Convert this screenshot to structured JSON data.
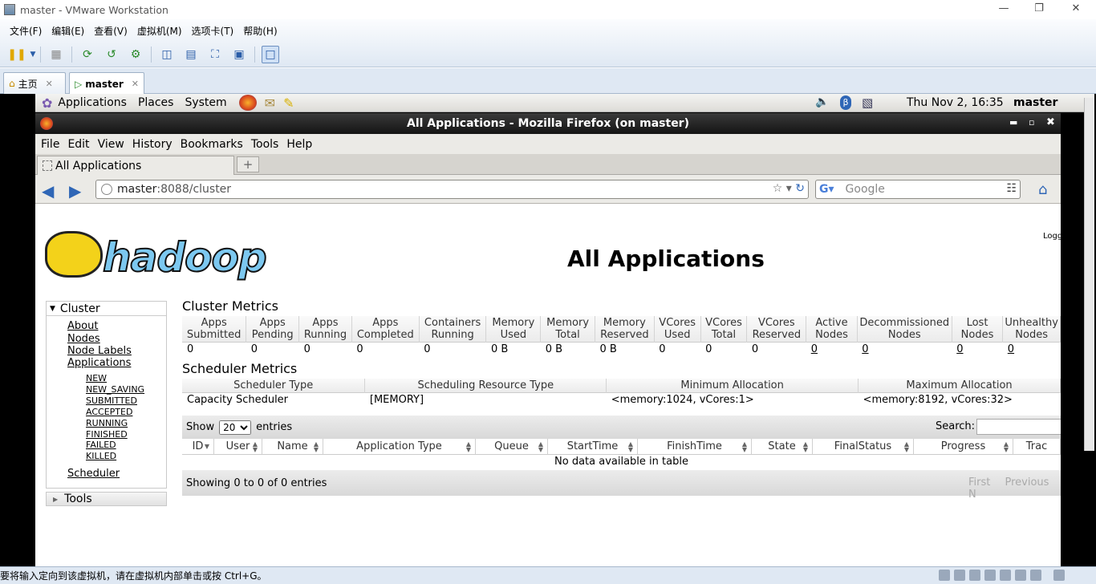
{
  "vm": {
    "title": "master - VMware Workstation",
    "menu": [
      "文件(F)",
      "编辑(E)",
      "查看(V)",
      "虚拟机(M)",
      "选项卡(T)",
      "帮助(H)"
    ],
    "tabs": [
      {
        "label": "主页"
      },
      {
        "label": "master"
      }
    ],
    "status_text": "要将输入定向到该虚拟机，请在虚拟机内部单击或按 Ctrl+G。"
  },
  "gnome": {
    "menus": [
      "Applications",
      "Places",
      "System"
    ],
    "clock": "Thu Nov  2, 16:35",
    "user": "master"
  },
  "firefox": {
    "window_title": "All Applications - Mozilla Firefox (on master)",
    "menu": [
      "File",
      "Edit",
      "View",
      "History",
      "Bookmarks",
      "Tools",
      "Help"
    ],
    "tab_title": "All Applications",
    "url_host": "master",
    "url_rest": ":8088/cluster",
    "search_placeholder": "Google"
  },
  "page": {
    "title": "All Applications",
    "logged": "Logg",
    "logo_text": "hadoop",
    "cluster_label": "Cluster",
    "nav": [
      "About",
      "Nodes",
      "Node Labels",
      "Applications"
    ],
    "app_states": [
      "NEW",
      "NEW_SAVING",
      "SUBMITTED",
      "ACCEPTED",
      "RUNNING",
      "FINISHED",
      "FAILED",
      "KILLED"
    ],
    "scheduler_link": "Scheduler",
    "tools_label": "Tools",
    "cluster_metrics_title": "Cluster Metrics",
    "cluster_metrics": {
      "headers": [
        [
          "Apps",
          "Submitted"
        ],
        [
          "Apps",
          "Pending"
        ],
        [
          "Apps",
          "Running"
        ],
        [
          "Apps",
          "Completed"
        ],
        [
          "Containers",
          "Running"
        ],
        [
          "Memory",
          "Used"
        ],
        [
          "Memory",
          "Total"
        ],
        [
          "Memory",
          "Reserved"
        ],
        [
          "VCores",
          "Used"
        ],
        [
          "VCores",
          "Total"
        ],
        [
          "VCores",
          "Reserved"
        ],
        [
          "Active",
          "Nodes"
        ],
        [
          "Decommissioned",
          "Nodes"
        ],
        [
          "Lost",
          "Nodes"
        ],
        [
          "Unhealthy",
          "Nodes"
        ]
      ],
      "values": [
        "0",
        "0",
        "0",
        "0",
        "0",
        "0 B",
        "0 B",
        "0 B",
        "0",
        "0",
        "0",
        "0",
        "0",
        "0",
        "0"
      ]
    },
    "scheduler_metrics_title": "Scheduler Metrics",
    "scheduler_metrics": {
      "headers": [
        "Scheduler Type",
        "Scheduling Resource Type",
        "Minimum Allocation",
        "Maximum Allocation"
      ],
      "values": [
        "Capacity Scheduler",
        "[MEMORY]",
        "<memory:1024, vCores:1>",
        "<memory:8192, vCores:32>"
      ]
    },
    "show_label": "Show",
    "entries_value": "20",
    "entries_label": "entries",
    "search_label": "Search:",
    "apps_table_headers": [
      "ID",
      "User",
      "Name",
      "Application Type",
      "Queue",
      "StartTime",
      "FinishTime",
      "State",
      "FinalStatus",
      "Progress",
      "Trac"
    ],
    "no_data": "No data available in table",
    "showing": "Showing 0 to 0 of 0 entries",
    "pager": [
      "First",
      "Previous",
      "N"
    ]
  }
}
